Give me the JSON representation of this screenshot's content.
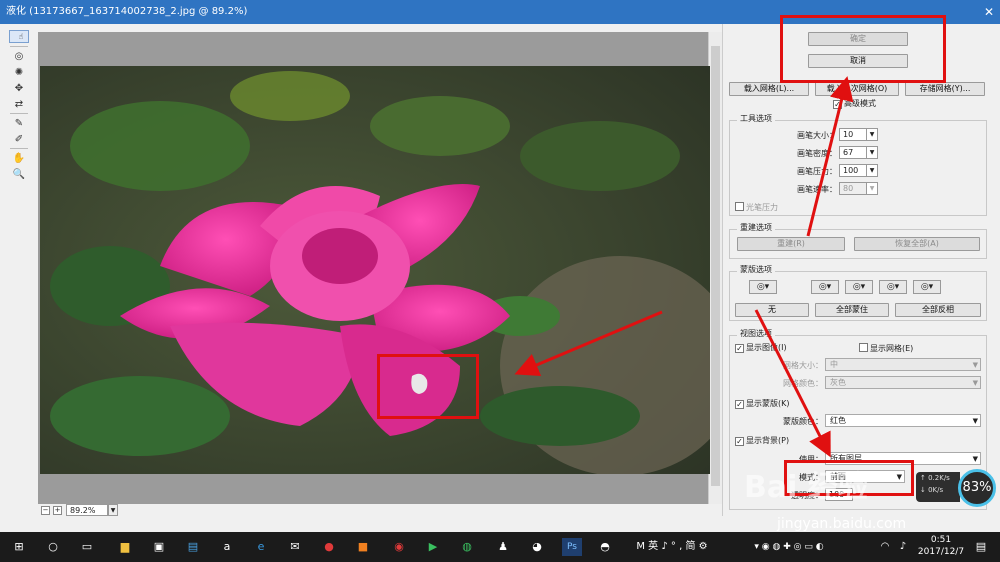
{
  "window": {
    "title": "液化 (13173667_163714002738_2.jpg @ 89.2%)",
    "close": "✕"
  },
  "tools": [
    {
      "name": "forward-warp-tool-icon",
      "glyph": "☝"
    },
    {
      "name": "reconstruct-tool-icon",
      "glyph": "✑"
    },
    {
      "name": "twirl-tool-icon",
      "glyph": "◎"
    },
    {
      "name": "pucker-tool-icon",
      "glyph": "✺"
    },
    {
      "name": "bloat-tool-icon",
      "glyph": "✥"
    },
    {
      "name": "push-left-tool-icon",
      "glyph": "⇄"
    },
    {
      "name": "freeze-mask-tool-icon",
      "glyph": "✎"
    },
    {
      "name": "thaw-mask-tool-icon",
      "glyph": "✐"
    },
    {
      "name": "hand-tool-icon",
      "glyph": "✋"
    },
    {
      "name": "zoom-tool-icon",
      "glyph": "🔍"
    }
  ],
  "status": {
    "zoom": "89.2%",
    "minus": "−",
    "plus": "+"
  },
  "panel": {
    "ok": "确定",
    "cancel": "取消",
    "load_mesh": "载入网格(L)...",
    "load_last_mesh": "载入上次网格(O)",
    "save_mesh": "存储网格(Y)...",
    "advanced_mode": "高级模式",
    "tool_options": "工具选项",
    "brush_size_label": "画笔大小：",
    "brush_size": "10",
    "brush_density_label": "画笔密度：",
    "brush_density": "67",
    "brush_pressure_label": "画笔压力：",
    "brush_pressure": "100",
    "brush_rate_label": "画笔速率：",
    "brush_rate": "80",
    "stylus_pressure": "光笔压力",
    "reconstruct_options": "重建选项",
    "reconstruct": "重建(R)",
    "restore_all": "恢复全部(A)",
    "mask_options": "蒙版选项",
    "none": "无",
    "mask_all": "全部蒙住",
    "invert_all": "全部反相",
    "view_options": "视图选项",
    "show_image": "显示图像(I)",
    "show_mesh": "显示网格(E)",
    "mesh_size_label": "网格大小：",
    "mesh_size": "中",
    "mesh_color_label": "网格颜色：",
    "mesh_color": "灰色",
    "show_mask": "显示蒙版(K)",
    "mask_color_label": "蒙版颜色：",
    "mask_color": "红色",
    "show_backdrop": "显示背景(P)",
    "use_label": "使用：",
    "use": "所有图层",
    "mode_label": "模式：",
    "mode": "前面",
    "opacity_label": "透明度：",
    "opacity": "100"
  },
  "watermark": {
    "text": "Bai 经验",
    "url": "jingyan.baidu.com",
    "percent": "83%",
    "up": "↑ 0.2K/s",
    "down": "↓ 0K/s"
  },
  "taskbar": {
    "ime": "M 英 ♪ ° , 简 ⚙",
    "time": "0:51",
    "date": "2017/12/7"
  },
  "colors": {
    "accent": "#2f74c2",
    "annotation": "#e01010"
  }
}
